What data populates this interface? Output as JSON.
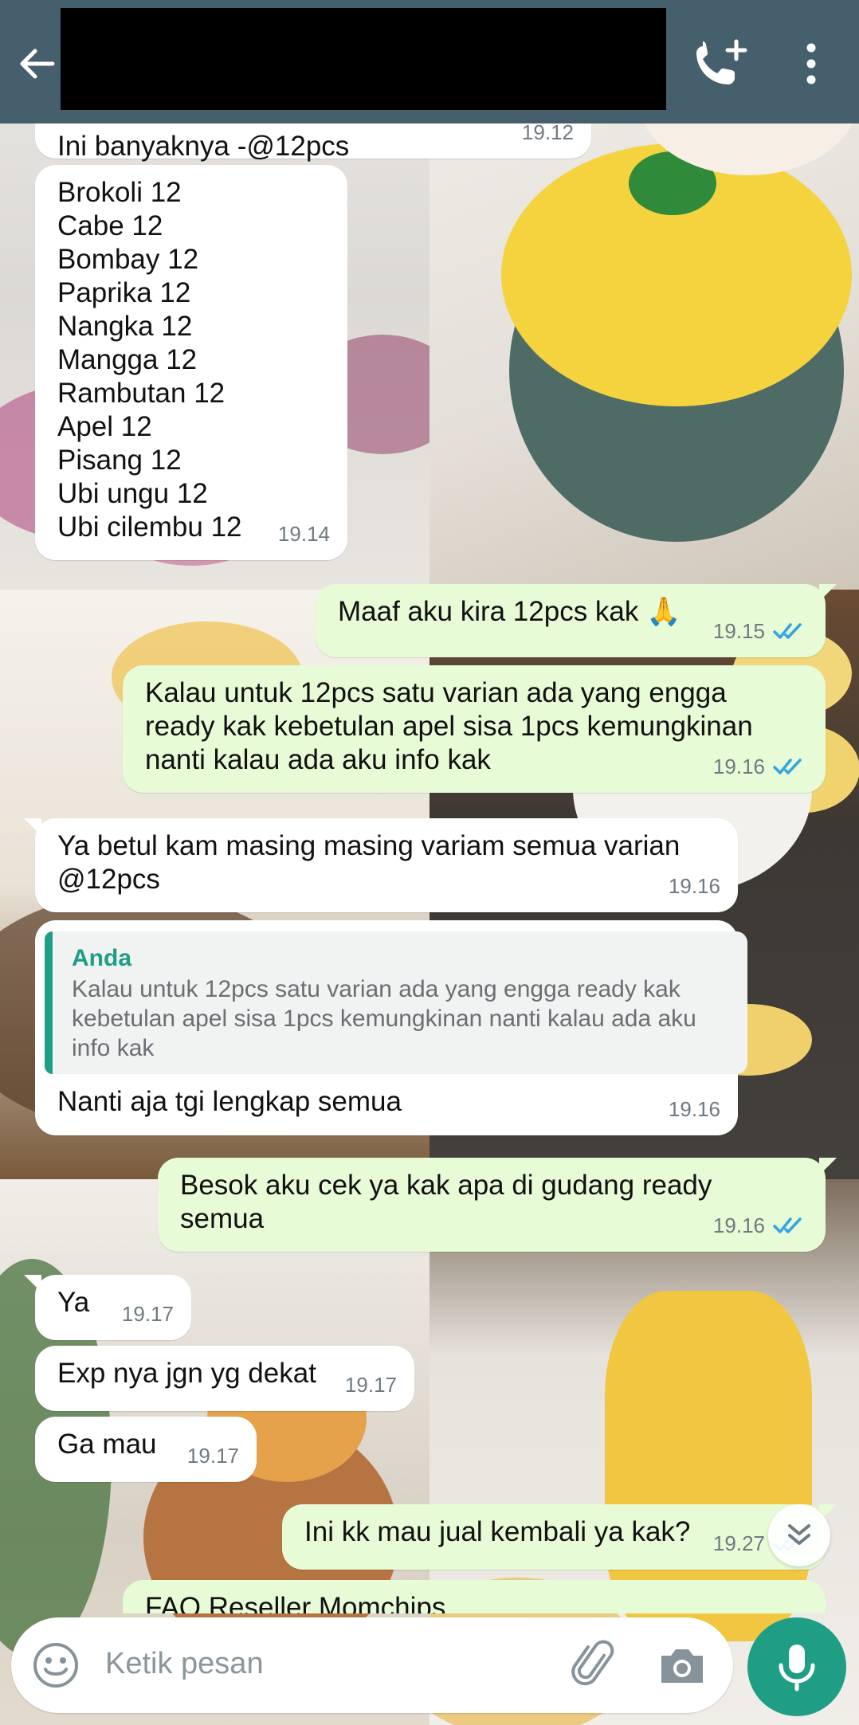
{
  "header": {
    "back_icon": "arrow-left-icon",
    "call_icon": "add-call-icon",
    "menu_icon": "more-vertical-icon"
  },
  "messages": [
    {
      "dir": "in",
      "text": "Ini banyaknya -@12pcs",
      "time": "19.12"
    },
    {
      "dir": "in",
      "text": "Brokoli 12\nCabe 12\nBombay 12\nPaprika 12\nNangka 12\nMangga 12\nRambutan 12\nApel 12\nPisang 12\nUbi ungu 12\nUbi cilembu 12",
      "time": "19.14"
    },
    {
      "dir": "out",
      "text": "Maaf aku kira 12pcs kak 🙏",
      "time": "19.15",
      "status": "read"
    },
    {
      "dir": "out",
      "text": "Kalau untuk 12pcs satu varian ada yang engga ready kak kebetulan apel sisa 1pcs kemungkinan nanti kalau ada aku info kak",
      "time": "19.16",
      "status": "read"
    },
    {
      "dir": "in",
      "text": "Ya betul kam masing masing variam semua varian @12pcs",
      "time": "19.16"
    },
    {
      "dir": "in",
      "quote_name": "Anda",
      "quote_text": "Kalau untuk 12pcs satu varian ada yang engga ready kak kebetulan apel sisa 1pcs kemungkinan nanti kalau ada aku info kak",
      "text": "Nanti aja tgi lengkap semua",
      "time": "19.16"
    },
    {
      "dir": "out",
      "text": "Besok aku cek ya kak apa di gudang ready semua",
      "time": "19.16",
      "status": "read"
    },
    {
      "dir": "in",
      "text": "Ya",
      "time": "19.17"
    },
    {
      "dir": "in",
      "text": "Exp nya jgn yg dekat",
      "time": "19.17"
    },
    {
      "dir": "in",
      "text": "Ga mau",
      "time": "19.17"
    },
    {
      "dir": "out",
      "text": "Ini kk mau jual kembali ya kak?",
      "time": "19.27",
      "status": "read"
    },
    {
      "dir": "out",
      "text": "FAQ Reseller Momchips",
      "time": ""
    }
  ],
  "composer": {
    "placeholder": "Ketik pesan",
    "emoji_icon": "emoji-icon",
    "attach_icon": "paperclip-icon",
    "camera_icon": "camera-icon",
    "mic_icon": "microphone-icon"
  },
  "colors": {
    "header": "#465f6c",
    "incoming": "#ffffff",
    "outgoing": "#e7fbd7",
    "accent": "#1f9e85",
    "read_ticks": "#35a4e0"
  }
}
